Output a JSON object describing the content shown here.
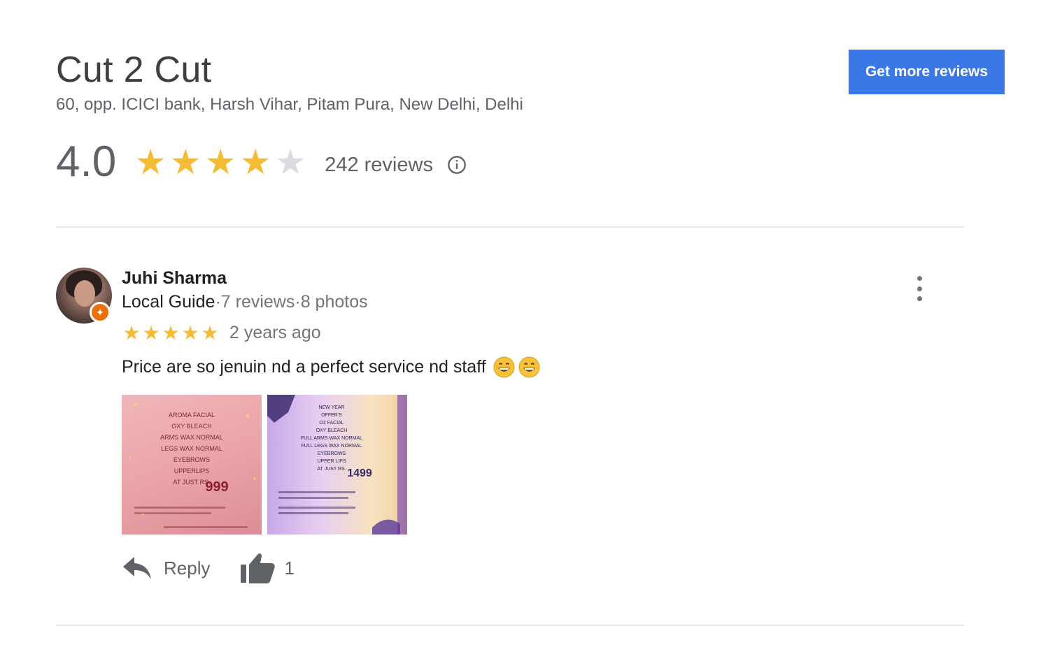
{
  "business": {
    "name": "Cut 2 Cut",
    "address": "60, opp. ICICI bank, Harsh Vihar, Pitam Pura, New Delhi, Delhi",
    "cta_label": "Get more reviews",
    "cta_color": "#3b78e7",
    "rating": "4.0",
    "rating_stars_filled": 4,
    "rating_stars_total": 5,
    "review_count": "242 reviews",
    "info_icon": "info-icon"
  },
  "review": {
    "reviewer_name": "Juhi Sharma",
    "reviewer_badge": "Local Guide",
    "reviewer_reviews": "7 reviews",
    "reviewer_photos": "8 photos",
    "separator": " · ",
    "stars_filled": 5,
    "stars_total": 5,
    "time": "2 years ago",
    "text": "Price are so jenuin nd a perfect service nd staff",
    "emojis": [
      "grinning-face-emoji",
      "grinning-face-emoji"
    ],
    "photos": [
      {
        "name": "photo-price-list-pink",
        "lines": [
          "AROMA FACIAL",
          "OXY BLEACH",
          "ARMS WAX NORMAL",
          "LEGS WAX NORMAL",
          "EYEBROWS",
          "UPPERLIPS",
          "AT JUST RS."
        ],
        "price": "999"
      },
      {
        "name": "photo-price-list-purple",
        "lines": [
          "NEW YEAR",
          "OFFER'S",
          "O3 FACIAL",
          "OXY BLEACH",
          "FULL ARMS WAX NORMAL",
          "FULL LEGS WAX NORMAL",
          "EYEBROWS",
          "UPPER LIPS",
          "AT JUST RS."
        ],
        "price": "1499"
      }
    ],
    "reply_label": "Reply",
    "like_count": "1"
  },
  "colors": {
    "star_on": "#f6bb34",
    "star_off": "#dadce0",
    "guide_badge": "#e8710a"
  }
}
